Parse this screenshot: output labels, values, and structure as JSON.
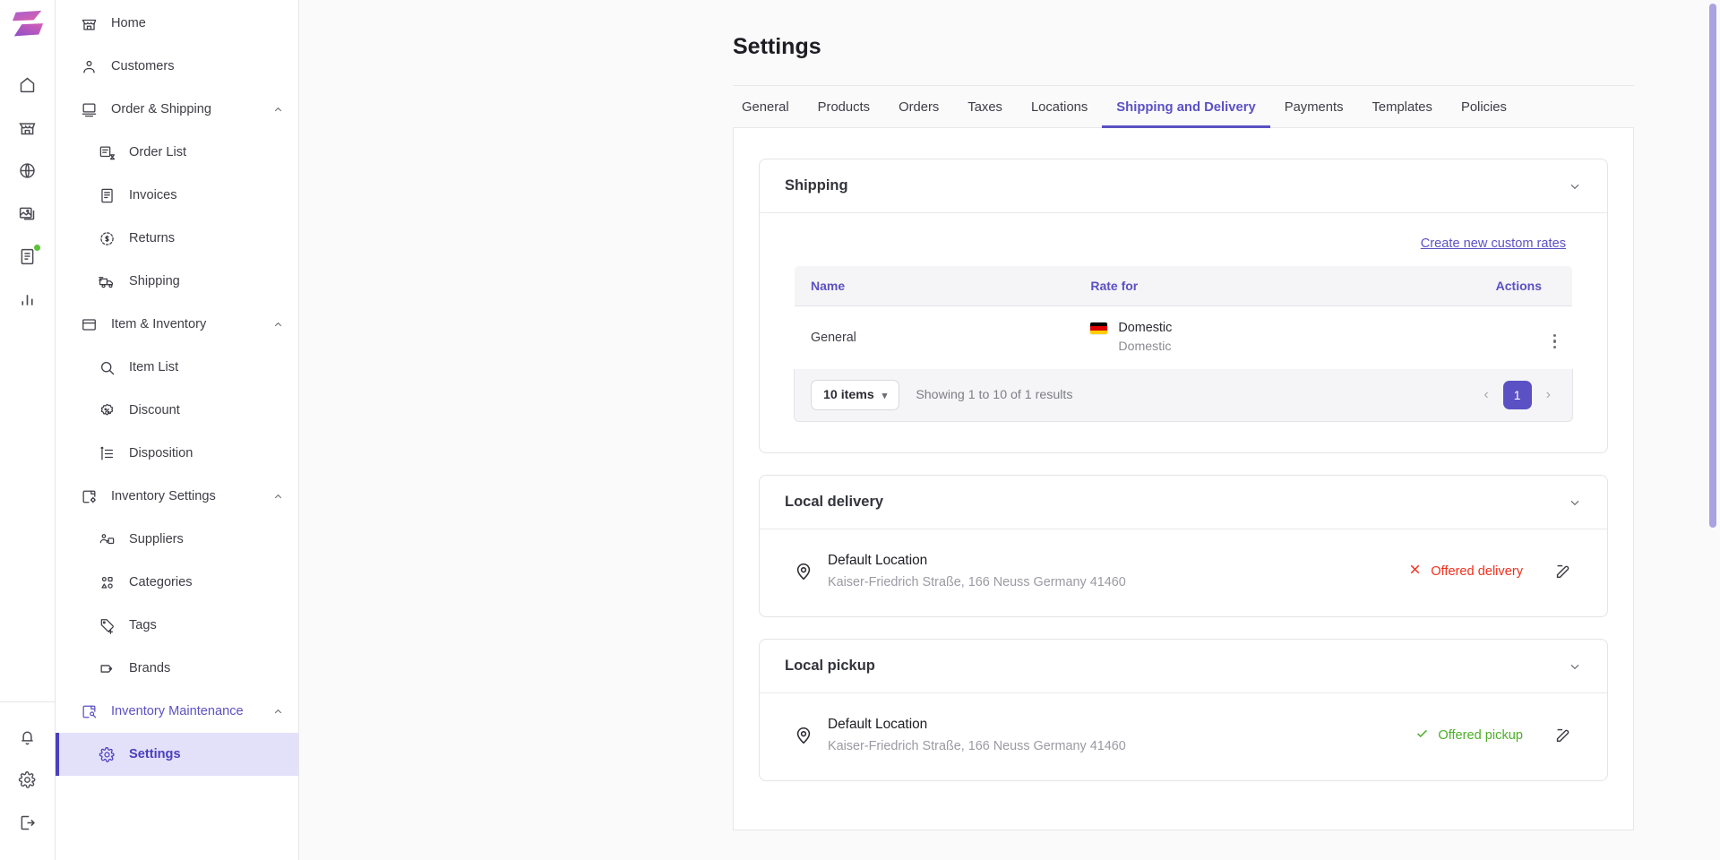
{
  "rail": {
    "logo_name": "app-logo",
    "icons": [
      {
        "name": "home-icon",
        "badge": false
      },
      {
        "name": "store-icon",
        "badge": false
      },
      {
        "name": "globe-icon",
        "badge": false
      },
      {
        "name": "images-icon",
        "badge": false
      },
      {
        "name": "document-icon",
        "badge": true
      },
      {
        "name": "analytics-icon",
        "badge": false
      }
    ],
    "bottom_icons": [
      {
        "name": "bell-icon"
      },
      {
        "name": "gear-icon"
      },
      {
        "name": "logout-icon"
      }
    ]
  },
  "sidebar": {
    "items": [
      {
        "label": "Home",
        "icon": "store-icon",
        "level": "top",
        "caret": "",
        "state": ""
      },
      {
        "label": "Customers",
        "icon": "person-icon",
        "level": "top",
        "caret": "",
        "state": ""
      },
      {
        "label": "Order & Shipping",
        "icon": "order-icon",
        "level": "top",
        "caret": "up",
        "state": ""
      },
      {
        "label": "Order List",
        "icon": "order-list-icon",
        "level": "child",
        "caret": "",
        "state": ""
      },
      {
        "label": "Invoices",
        "icon": "invoice-icon",
        "level": "child",
        "caret": "",
        "state": ""
      },
      {
        "label": "Returns",
        "icon": "returns-icon",
        "level": "child",
        "caret": "",
        "state": ""
      },
      {
        "label": "Shipping",
        "icon": "truck-icon",
        "level": "child",
        "caret": "",
        "state": ""
      },
      {
        "label": "Item & Inventory",
        "icon": "box-icon",
        "level": "top",
        "caret": "up",
        "state": ""
      },
      {
        "label": "Item List",
        "icon": "search-icon",
        "level": "child",
        "caret": "",
        "state": ""
      },
      {
        "label": "Discount",
        "icon": "discount-icon",
        "level": "child",
        "caret": "",
        "state": ""
      },
      {
        "label": "Disposition",
        "icon": "disposition-icon",
        "level": "child",
        "caret": "",
        "state": ""
      },
      {
        "label": "Inventory Settings",
        "icon": "inventory-settings-icon",
        "level": "top",
        "caret": "up",
        "state": ""
      },
      {
        "label": "Suppliers",
        "icon": "suppliers-icon",
        "level": "child",
        "caret": "",
        "state": ""
      },
      {
        "label": "Categories",
        "icon": "categories-icon",
        "level": "child",
        "caret": "",
        "state": ""
      },
      {
        "label": "Tags",
        "icon": "tag-plus-icon",
        "level": "child",
        "caret": "",
        "state": ""
      },
      {
        "label": "Brands",
        "icon": "tag-icon",
        "level": "child",
        "caret": "",
        "state": ""
      },
      {
        "label": "Inventory Maintenance",
        "icon": "maintenance-icon",
        "level": "top",
        "caret": "up",
        "state": "accent"
      },
      {
        "label": "Settings",
        "icon": "gear-icon",
        "level": "child",
        "caret": "",
        "state": "active"
      }
    ]
  },
  "header": {
    "title": "Settings"
  },
  "tabs": [
    {
      "label": "General",
      "active": false
    },
    {
      "label": "Products",
      "active": false
    },
    {
      "label": "Orders",
      "active": false
    },
    {
      "label": "Taxes",
      "active": false
    },
    {
      "label": "Locations",
      "active": false
    },
    {
      "label": "Shipping and Delivery",
      "active": true
    },
    {
      "label": "Payments",
      "active": false
    },
    {
      "label": "Templates",
      "active": false
    },
    {
      "label": "Policies",
      "active": false
    }
  ],
  "shipping": {
    "card_title": "Shipping",
    "create_link": "Create new custom rates",
    "table": {
      "columns": [
        "Name",
        "Rate for",
        "Actions"
      ],
      "rows": [
        {
          "name": "General",
          "rate_flag": "germany-flag",
          "rate_title": "Domestic",
          "rate_subtitle": "Domestic"
        }
      ]
    },
    "footer": {
      "page_size": "10 items",
      "showing": "Showing 1 to 10 of 1 results",
      "prev": "‹",
      "page": "1",
      "next": "›"
    }
  },
  "local_delivery": {
    "card_title": "Local delivery",
    "location_name": "Default Location",
    "location_address": "Kaiser-Friedrich Straße, 166 Neuss Germany 41460",
    "status": "Offered delivery",
    "status_icon": "cross-icon"
  },
  "local_pickup": {
    "card_title": "Local pickup",
    "location_name": "Default Location",
    "location_address": "Kaiser-Friedrich Straße, 166 Neuss Germany 41460",
    "status": "Offered pickup",
    "status_icon": "check-icon"
  },
  "colors": {
    "accent": "#5b51c4",
    "active_bg": "#e3e0fa",
    "danger": "#f0301c",
    "success": "#4caf28",
    "badge": "#5bc236"
  }
}
